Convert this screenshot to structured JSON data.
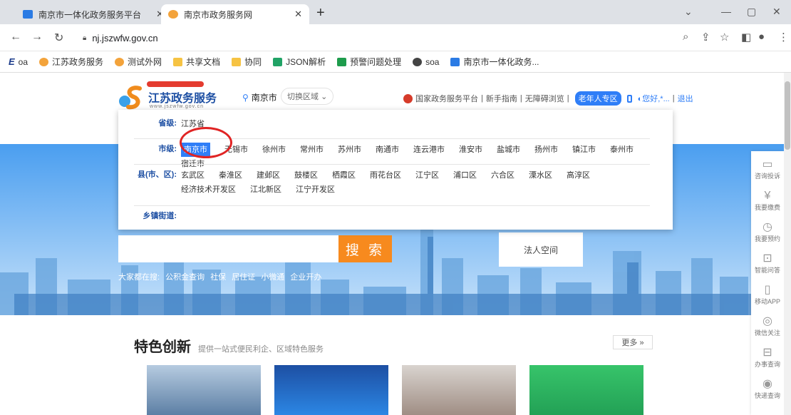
{
  "browser": {
    "tabs": [
      {
        "title": "南京市一体化政务服务平台"
      },
      {
        "title": "南京市政务服务网"
      }
    ],
    "url": "nj.jszwfw.gov.cn",
    "bookmarks": [
      "oa",
      "江苏政务服务",
      "测试外网",
      "共享文档",
      "协同",
      "JSON解析",
      "预警问题处理",
      "soa",
      "南京市一体化政务..."
    ],
    "colors": {
      "tabbar": "#dee1e6",
      "active_tab": "#ffffff"
    }
  },
  "site": {
    "logo_title": "江苏政务服务",
    "logo_domain": "www.jszwfw.gov.cn",
    "city": "南京市",
    "switch_label": "切换区域",
    "top_links": {
      "national": "国家政务服务平台",
      "guide": "新手指南",
      "barrier_free": "无障碍浏览",
      "elder": "老年人专区",
      "greeting": "您好,*...",
      "logout": "退出"
    },
    "accent": "#2f7ef7",
    "search_orange": "#f78a1e"
  },
  "region_panel": {
    "province_label": "省级:",
    "province": "江苏省",
    "city_label": "市级:",
    "cities": [
      "南京市",
      "无锡市",
      "徐州市",
      "常州市",
      "苏州市",
      "南通市",
      "连云港市",
      "淮安市",
      "盐城市",
      "扬州市",
      "镇江市",
      "泰州市",
      "宿迁市"
    ],
    "selected_city": "南京市",
    "county_label": "县(市、区):",
    "counties": [
      "玄武区",
      "秦淮区",
      "建邺区",
      "鼓楼区",
      "栖霞区",
      "雨花台区",
      "江宁区",
      "浦口区",
      "六合区",
      "溧水区",
      "高淳区",
      "经济技术开发区",
      "江北新区",
      "江宁开发区"
    ],
    "town_label": "乡镇街道:"
  },
  "search": {
    "button": "搜 索",
    "legal_space": "法人空间",
    "hot_prefix": "大家都在搜:",
    "hot_terms": [
      "公积金查询",
      "社保",
      "居住证",
      "小微通",
      "企业开办"
    ]
  },
  "feature": {
    "title": "特色创新",
    "subtitle": "提供一站式便民利企、区域特色服务",
    "more": "更多 »"
  },
  "side_tools": [
    "咨询投诉",
    "我要缴费",
    "我要预约",
    "智能问答",
    "移动APP",
    "微信关注",
    "办事查询",
    "快递查询"
  ]
}
